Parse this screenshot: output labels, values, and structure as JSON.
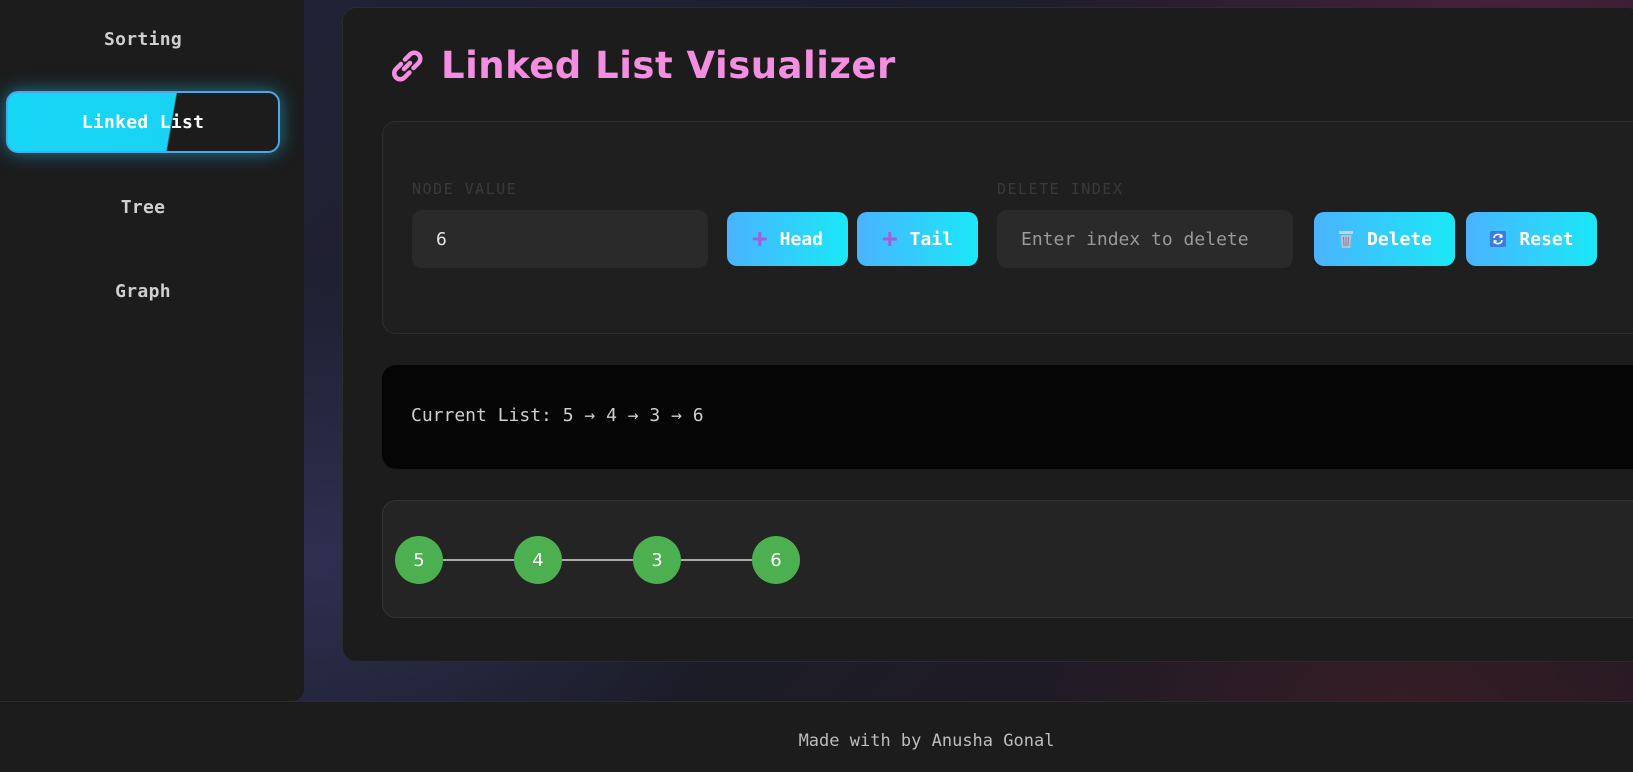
{
  "sidebar": {
    "items": [
      {
        "label": "Sorting",
        "active": false
      },
      {
        "label": "Linked List",
        "active": true
      },
      {
        "label": "Tree",
        "active": false
      },
      {
        "label": "Graph",
        "active": false
      }
    ]
  },
  "main": {
    "title": "Linked List Visualizer",
    "title_icon": "link-icon",
    "title_color": "#f38ee0"
  },
  "controls": {
    "node_value_label": "NODE VALUE",
    "node_value": "6",
    "add_head_label": "Head",
    "add_tail_label": "Tail",
    "delete_index_label": "DELETE INDEX",
    "delete_index_placeholder": "Enter index to delete",
    "delete_label": "Delete",
    "reset_label": "Reset",
    "icons": {
      "add": "plus-icon",
      "delete": "trash-icon",
      "reset": "refresh-icon"
    }
  },
  "current_list": {
    "text": "Current List: 5 → 4 → 3 → 6"
  },
  "visualization": {
    "nodes": [
      "5",
      "4",
      "3",
      "6"
    ],
    "node_color": "#4caf50"
  },
  "footer": {
    "text": "Made with by Anusha Gonal"
  },
  "colors": {
    "accent_cyan": "#17d6f6",
    "button_gradient_start": "#4ab3ff",
    "button_gradient_end": "#1ae8f8"
  }
}
